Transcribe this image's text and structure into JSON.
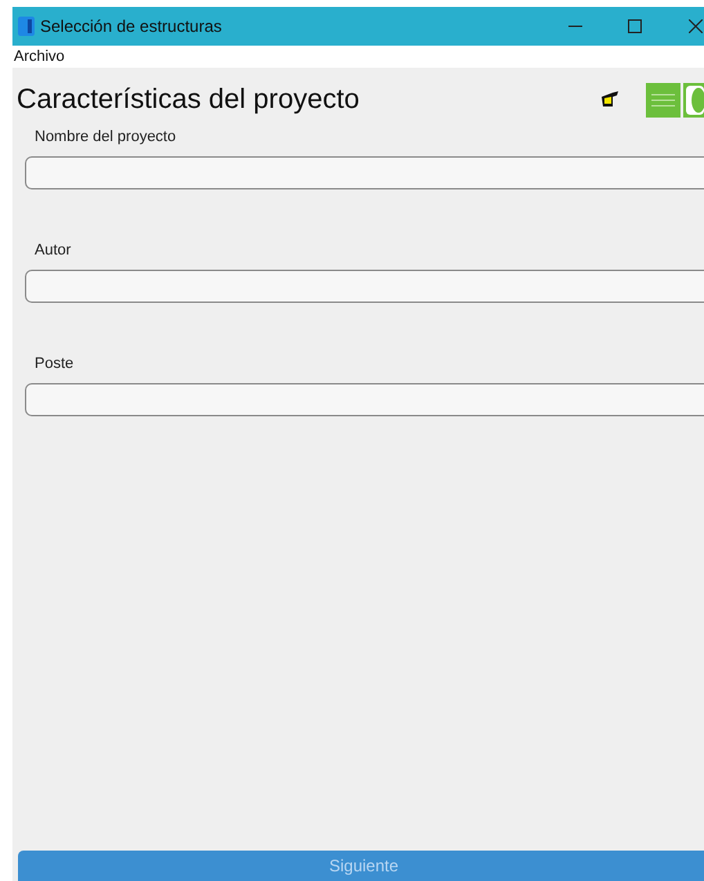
{
  "window": {
    "title": "Selección de estructuras"
  },
  "menu": [
    "Archivo"
  ],
  "heading": "Características del proyecto",
  "fields": [
    {
      "label": "Nombre del proyecto"
    },
    {
      "label": "Autor"
    },
    {
      "label": "Poste"
    }
  ],
  "button": {
    "label": "Siguiente",
    "disabled": true
  }
}
